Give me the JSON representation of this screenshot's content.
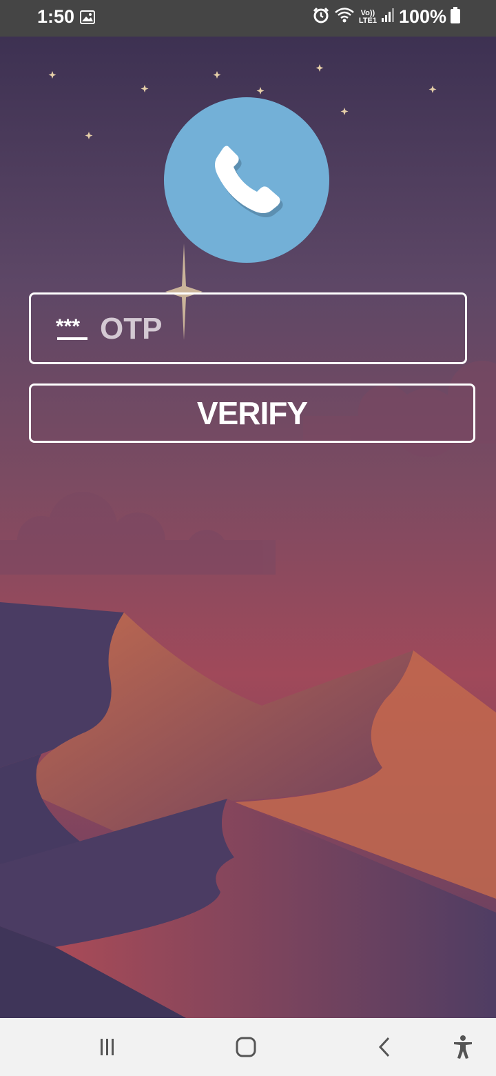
{
  "status_bar": {
    "time": "1:50",
    "network_label_top": "Vo))",
    "network_label_bottom": "LTE1",
    "battery": "100%",
    "icons": [
      "gallery-icon",
      "alarm-icon",
      "wifi-icon",
      "signal-icon",
      "battery-icon"
    ]
  },
  "avatar": {
    "icon": "phone-icon",
    "color": "#73b0d7"
  },
  "otp": {
    "icon": "password-dots-icon",
    "placeholder": "OTP",
    "value": ""
  },
  "verify_button": {
    "label": "VERIFY"
  },
  "nav_bar": {
    "icons": [
      "recent-apps-icon",
      "home-icon",
      "back-icon",
      "accessibility-icon"
    ]
  }
}
